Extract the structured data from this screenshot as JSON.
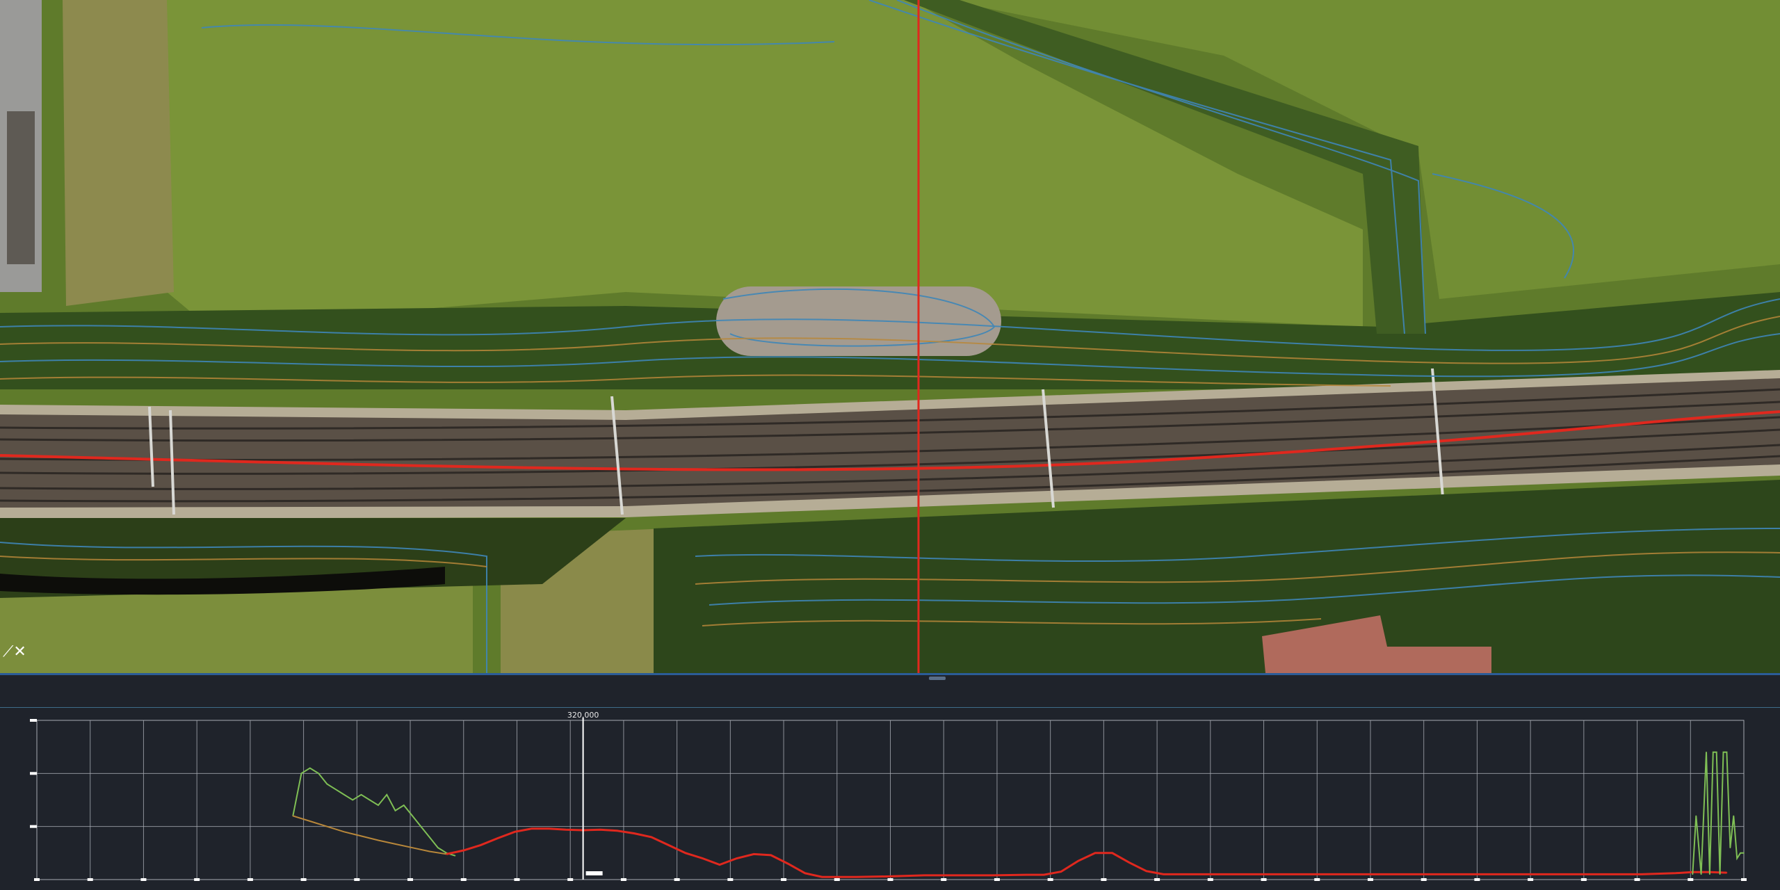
{
  "map": {
    "colors": {
      "field": "#6b8a2e",
      "meadow_light": "#7d9838",
      "dry_strip": "#8f8a4a",
      "hedge": "#2f4a1a",
      "track_bed": "#5b5146",
      "rail": "#3a3430",
      "gravel_pad": "#a39a8e",
      "roof": "#b0685a",
      "contour_blue": "#3f86b8",
      "contour_orange": "#b8873a",
      "alignment_red": "#e0281e",
      "section_line": "#e0281e"
    },
    "close_icon": "close-icon"
  },
  "splitter": {
    "handle_icon": "drag-handle-icon"
  },
  "profile": {
    "station_label": "320.000",
    "colors": {
      "background": "#1f232b",
      "grid": "#a7abb3",
      "terrain_line": "#7fbf55",
      "ground_line": "#e0281e",
      "design_line": "#b8873a",
      "cursor_line": "#ffffff"
    }
  },
  "chart_data": {
    "type": "line",
    "title": "",
    "xlabel": "",
    "ylabel": "",
    "xlim": [
      0,
      1000
    ],
    "ylim": [
      0,
      30
    ],
    "grid": true,
    "cursor_x": 320,
    "series": [
      {
        "x": [
          150,
          155,
          160,
          165,
          170,
          175,
          180,
          185,
          190,
          195,
          200,
          205,
          210,
          215,
          220,
          225,
          230,
          235,
          240,
          245
        ],
        "values": [
          12,
          20,
          21,
          20,
          18,
          17,
          16,
          15,
          16,
          15,
          14,
          16,
          13,
          14,
          12,
          10,
          8,
          6,
          5,
          4.5
        ]
      },
      {
        "x": [
          150,
          160,
          170,
          180,
          190,
          200,
          210,
          220,
          230,
          240
        ],
        "values": [
          12,
          11,
          10,
          9,
          8.2,
          7.4,
          6.7,
          6,
          5.3,
          4.8
        ]
      },
      {
        "x": [
          240,
          250,
          260,
          270,
          280,
          290,
          300,
          310,
          320,
          330,
          340,
          350,
          360,
          370,
          380,
          390,
          400,
          410,
          420,
          430,
          440,
          450,
          460,
          480,
          500,
          520,
          540,
          560,
          580,
          590,
          600,
          610,
          620,
          630,
          640,
          650,
          660,
          680,
          700,
          720,
          740,
          760,
          780,
          800,
          820,
          840,
          860,
          880,
          900,
          920,
          940,
          960,
          970,
          980,
          990
        ],
        "values": [
          4.8,
          5.5,
          6.5,
          7.8,
          9,
          9.6,
          9.6,
          9.4,
          9.3,
          9.4,
          9.2,
          8.7,
          8,
          6.5,
          5,
          4,
          2.8,
          4,
          4.8,
          4.6,
          3,
          1.2,
          0.5,
          0.5,
          0.6,
          0.8,
          0.8,
          0.8,
          0.9,
          0.9,
          1.5,
          3.5,
          5,
          5,
          3.2,
          1.6,
          1,
          1,
          1,
          1,
          1,
          1,
          1,
          1,
          1,
          1,
          1,
          1,
          1,
          1,
          1,
          1.2,
          1.4,
          1.4,
          1.3
        ]
      },
      {
        "x": [
          970,
          972,
          975,
          978,
          980,
          982,
          984,
          986,
          988,
          990,
          992,
          994,
          996,
          998,
          1000
        ],
        "values": [
          1,
          12,
          1,
          24,
          1,
          24,
          24,
          1,
          24,
          24,
          6,
          12,
          4,
          5,
          5
        ]
      }
    ]
  }
}
